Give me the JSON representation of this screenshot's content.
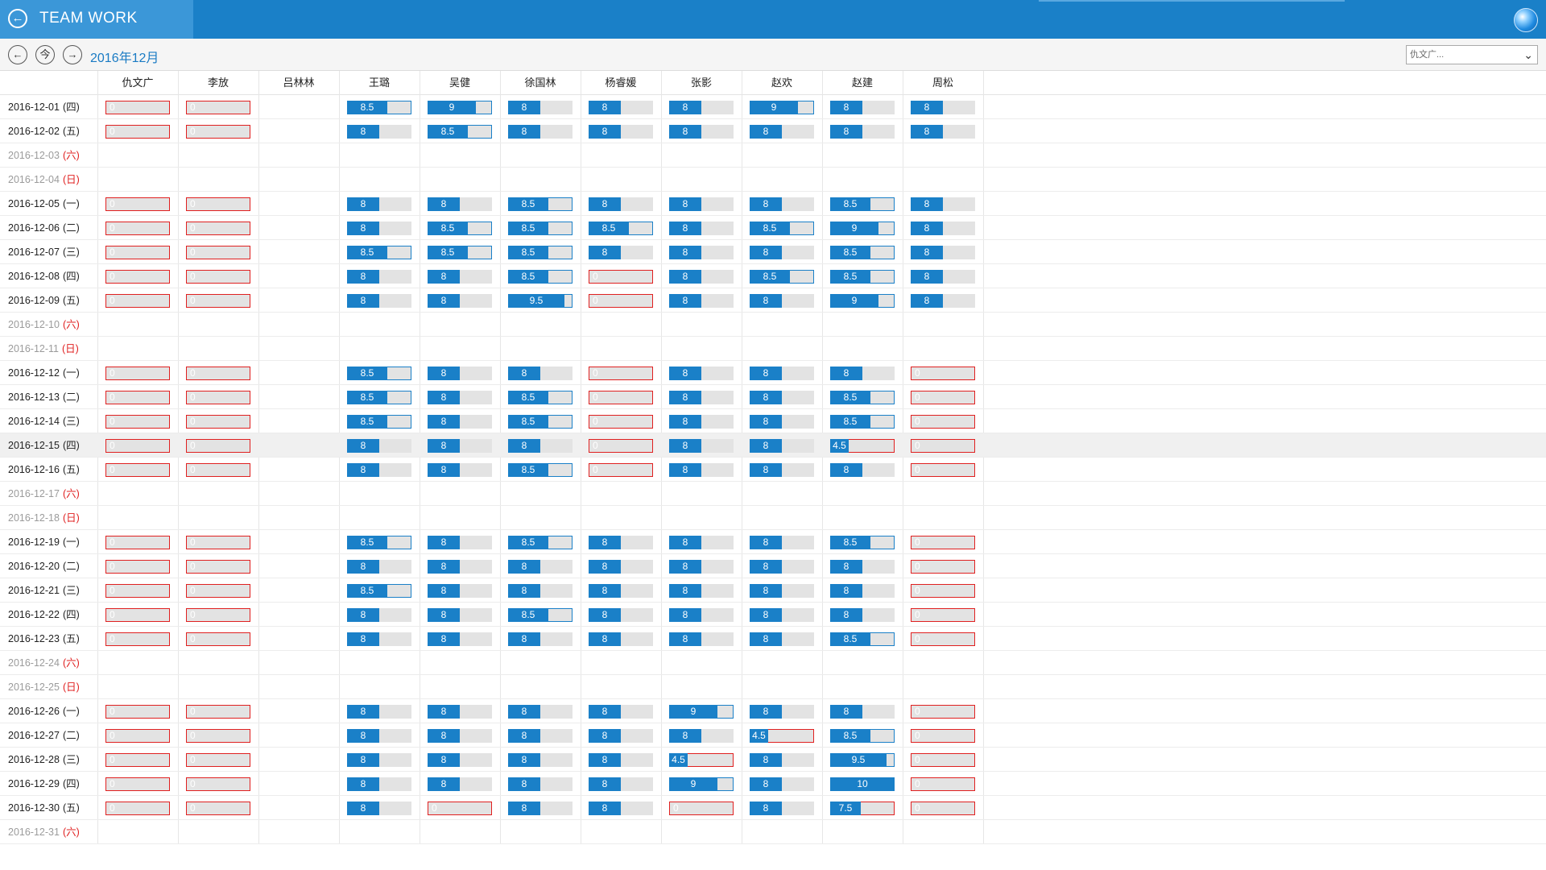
{
  "app": {
    "title": "TEAM WORK"
  },
  "nav": {
    "prev_symbol": "←",
    "today_symbol": "今",
    "next_symbol": "→",
    "month_label": "2016年12月"
  },
  "person_select": {
    "value": "仇文广...",
    "chevron": "⌄"
  },
  "columns": [
    "仇文广",
    "李放",
    "吕林林",
    "王璐",
    "吴健",
    "徐国林",
    "杨睿媛",
    "张影",
    "赵欢",
    "赵建",
    "周松"
  ],
  "colors": {
    "accent": "#1a80c8",
    "title_bar": "#1a80c8",
    "over_border": "#1a80c8",
    "under_border": "#e02020",
    "track": "#e3e3e3",
    "weekend_red": "#e02020"
  },
  "highlighted_row": 14,
  "rows": [
    {
      "date": "2016-12-01",
      "weekday": "(四)",
      "weekend": false,
      "values": [
        0,
        0,
        null,
        8.5,
        9,
        8,
        8,
        8,
        9,
        8,
        8
      ]
    },
    {
      "date": "2016-12-02",
      "weekday": "(五)",
      "weekend": false,
      "values": [
        0,
        0,
        null,
        8,
        8.5,
        8,
        8,
        8,
        8,
        8,
        8
      ]
    },
    {
      "date": "2016-12-03",
      "weekday": "(六)",
      "weekend": true,
      "values": []
    },
    {
      "date": "2016-12-04",
      "weekday": "(日)",
      "weekend": true,
      "values": []
    },
    {
      "date": "2016-12-05",
      "weekday": "(一)",
      "weekend": false,
      "values": [
        0,
        0,
        null,
        8,
        8,
        8.5,
        8,
        8,
        8,
        8.5,
        8
      ]
    },
    {
      "date": "2016-12-06",
      "weekday": "(二)",
      "weekend": false,
      "values": [
        0,
        0,
        null,
        8,
        8.5,
        8.5,
        8.5,
        8,
        8.5,
        9,
        8
      ]
    },
    {
      "date": "2016-12-07",
      "weekday": "(三)",
      "weekend": false,
      "values": [
        0,
        0,
        null,
        8.5,
        8.5,
        8.5,
        8,
        8,
        8,
        8.5,
        8
      ]
    },
    {
      "date": "2016-12-08",
      "weekday": "(四)",
      "weekend": false,
      "values": [
        0,
        0,
        null,
        8,
        8,
        8.5,
        0,
        8,
        8.5,
        8.5,
        8
      ]
    },
    {
      "date": "2016-12-09",
      "weekday": "(五)",
      "weekend": false,
      "values": [
        0,
        0,
        null,
        8,
        8,
        9.5,
        0,
        8,
        8,
        9,
        8
      ]
    },
    {
      "date": "2016-12-10",
      "weekday": "(六)",
      "weekend": true,
      "values": []
    },
    {
      "date": "2016-12-11",
      "weekday": "(日)",
      "weekend": true,
      "values": []
    },
    {
      "date": "2016-12-12",
      "weekday": "(一)",
      "weekend": false,
      "values": [
        0,
        0,
        null,
        8.5,
        8,
        8,
        0,
        8,
        8,
        8,
        0
      ]
    },
    {
      "date": "2016-12-13",
      "weekday": "(二)",
      "weekend": false,
      "values": [
        0,
        0,
        null,
        8.5,
        8,
        8.5,
        0,
        8,
        8,
        8.5,
        0
      ]
    },
    {
      "date": "2016-12-14",
      "weekday": "(三)",
      "weekend": false,
      "values": [
        0,
        0,
        null,
        8.5,
        8,
        8.5,
        0,
        8,
        8,
        8.5,
        0
      ]
    },
    {
      "date": "2016-12-15",
      "weekday": "(四)",
      "weekend": false,
      "values": [
        0,
        0,
        null,
        8,
        8,
        8,
        0,
        8,
        8,
        4.5,
        0
      ]
    },
    {
      "date": "2016-12-16",
      "weekday": "(五)",
      "weekend": false,
      "values": [
        0,
        0,
        null,
        8,
        8,
        8.5,
        0,
        8,
        8,
        8,
        0
      ]
    },
    {
      "date": "2016-12-17",
      "weekday": "(六)",
      "weekend": true,
      "values": []
    },
    {
      "date": "2016-12-18",
      "weekday": "(日)",
      "weekend": true,
      "values": []
    },
    {
      "date": "2016-12-19",
      "weekday": "(一)",
      "weekend": false,
      "values": [
        0,
        0,
        null,
        8.5,
        8,
        8.5,
        8,
        8,
        8,
        8.5,
        0
      ]
    },
    {
      "date": "2016-12-20",
      "weekday": "(二)",
      "weekend": false,
      "values": [
        0,
        0,
        null,
        8,
        8,
        8,
        8,
        8,
        8,
        8,
        0
      ]
    },
    {
      "date": "2016-12-21",
      "weekday": "(三)",
      "weekend": false,
      "values": [
        0,
        0,
        null,
        8.5,
        8,
        8,
        8,
        8,
        8,
        8,
        0
      ]
    },
    {
      "date": "2016-12-22",
      "weekday": "(四)",
      "weekend": false,
      "values": [
        0,
        0,
        null,
        8,
        8,
        8.5,
        8,
        8,
        8,
        8,
        0
      ]
    },
    {
      "date": "2016-12-23",
      "weekday": "(五)",
      "weekend": false,
      "values": [
        0,
        0,
        null,
        8,
        8,
        8,
        8,
        8,
        8,
        8.5,
        0
      ]
    },
    {
      "date": "2016-12-24",
      "weekday": "(六)",
      "weekend": true,
      "values": []
    },
    {
      "date": "2016-12-25",
      "weekday": "(日)",
      "weekend": true,
      "values": []
    },
    {
      "date": "2016-12-26",
      "weekday": "(一)",
      "weekend": false,
      "values": [
        0,
        0,
        null,
        8,
        8,
        8,
        8,
        9,
        8,
        8,
        0
      ]
    },
    {
      "date": "2016-12-27",
      "weekday": "(二)",
      "weekend": false,
      "values": [
        0,
        0,
        null,
        8,
        8,
        8,
        8,
        8,
        4.5,
        8.5,
        0
      ]
    },
    {
      "date": "2016-12-28",
      "weekday": "(三)",
      "weekend": false,
      "values": [
        0,
        0,
        null,
        8,
        8,
        8,
        8,
        4.5,
        8,
        9.5,
        0
      ]
    },
    {
      "date": "2016-12-29",
      "weekday": "(四)",
      "weekend": false,
      "values": [
        0,
        0,
        null,
        8,
        8,
        8,
        8,
        9,
        8,
        10,
        0
      ]
    },
    {
      "date": "2016-12-30",
      "weekday": "(五)",
      "weekend": false,
      "values": [
        0,
        0,
        null,
        8,
        0,
        8,
        8,
        0,
        8,
        7.5,
        0
      ]
    },
    {
      "date": "2016-12-31",
      "weekday": "(六)",
      "weekend": true,
      "values": []
    }
  ]
}
